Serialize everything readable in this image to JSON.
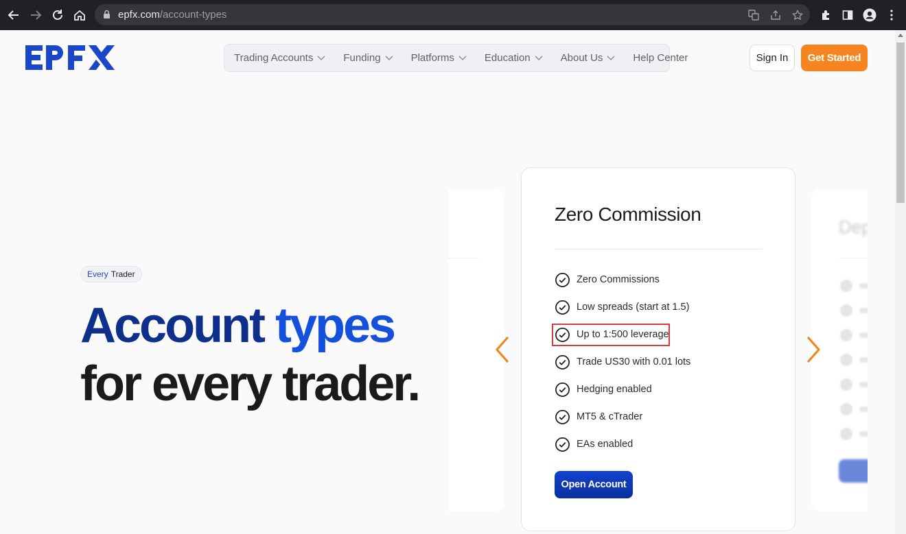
{
  "browser": {
    "url_host": "epfx.com",
    "url_path": "/account-types"
  },
  "header": {
    "logo_text": "EPFX",
    "nav": [
      {
        "label": "Trading Accounts",
        "has_dropdown": true
      },
      {
        "label": "Funding",
        "has_dropdown": true
      },
      {
        "label": "Platforms",
        "has_dropdown": true
      },
      {
        "label": "Education",
        "has_dropdown": true
      },
      {
        "label": "About Us",
        "has_dropdown": true
      },
      {
        "label": "Help Center",
        "has_dropdown": false
      }
    ],
    "signin_label": "Sign In",
    "getstarted_label": "Get Started"
  },
  "hero": {
    "badge_accent": "Every",
    "badge_rest": "Trader",
    "title_word1": "Account",
    "title_word2": "types",
    "title_line2": "for every trader."
  },
  "carousel": {
    "card": {
      "title": "Zero Commission",
      "features": [
        "Zero Commissions",
        "Low spreads (start at 1.5)",
        "Up to 1:500 leverage",
        "Trade US30 with 0.01 lots",
        "Hedging enabled",
        "MT5 & cTrader",
        "EAs enabled"
      ],
      "highlighted_feature_index": 2,
      "open_button_label": "Open Account"
    },
    "next_card_title_partial": "Dep"
  },
  "colors": {
    "brand_blue": "#0e2f8a",
    "accent_blue": "#1550dd",
    "orange": "#f7841f",
    "highlight_red": "#d93a3a"
  }
}
